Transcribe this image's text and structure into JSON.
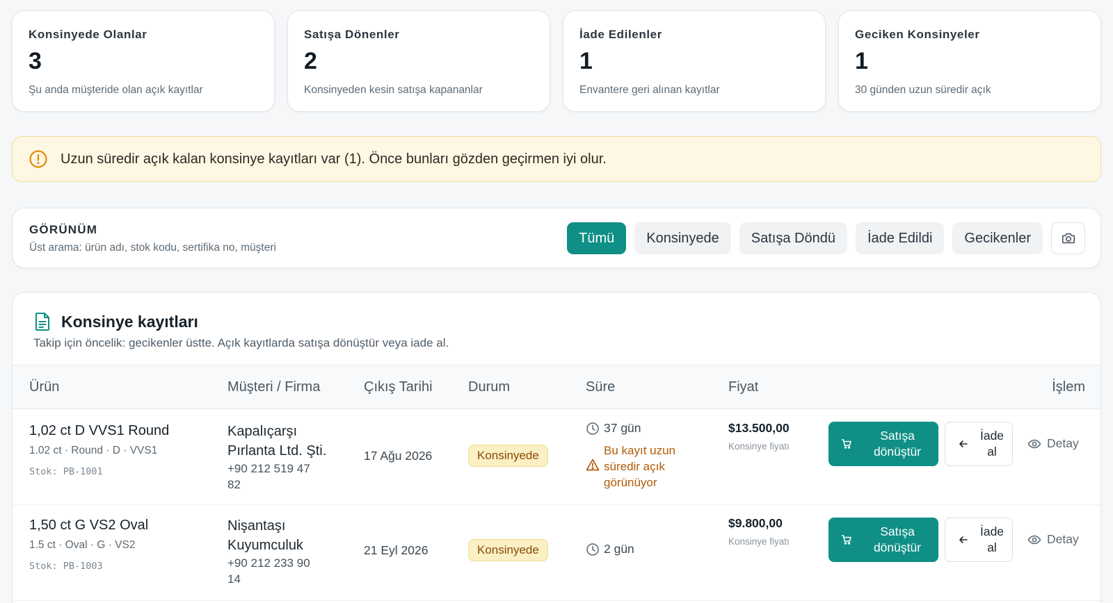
{
  "stats": [
    {
      "title": "Konsinyede Olanlar",
      "value": "3",
      "subtitle": "Şu anda müşteride olan açık kayıtlar"
    },
    {
      "title": "Satışa Dönenler",
      "value": "2",
      "subtitle": "Konsinyeden kesin satışa kapananlar"
    },
    {
      "title": "İade Edilenler",
      "value": "1",
      "subtitle": "Envantere geri alınan kayıtlar"
    },
    {
      "title": "Geciken Konsinyeler",
      "value": "1",
      "subtitle": "30 günden uzun süredir açık"
    }
  ],
  "alert": {
    "icon": "alert-circle-icon",
    "text": "Uzun süredir açık kalan konsinye kayıtları var (1). Önce bunları gözden geçirmen iyi olur.",
    "color": "#e28a0c"
  },
  "view": {
    "title": "GÖRÜNÜM",
    "subtitle": "Üst arama: ürün adı, stok kodu, sertifika no, müşteri",
    "filters": [
      "Tümü",
      "Konsinyede",
      "Satışa Döndü",
      "İade Edildi",
      "Gecikenler"
    ],
    "active_filter": "Tümü",
    "camera_icon": "camera-icon"
  },
  "records": {
    "title": "Konsinye kayıtları",
    "subtitle": "Takip için öncelik: gecikenler üstte. Açık kayıtlarda satışa dönüştür veya iade al.",
    "icon": "document-icon",
    "columns": [
      "Ürün",
      "Müşteri / Firma",
      "Çıkış Tarihi",
      "Durum",
      "Süre",
      "Fiyat",
      "İşlem"
    ],
    "rows": [
      {
        "product": "1,02 ct D VVS1 Round",
        "meta": "1.02 ct · Round · D · VVS1",
        "stock": "Stok: PB-1001",
        "customer": "Kapalıçarşı Pırlanta Ltd. Şti.",
        "phone": "+90 212 519 47 82",
        "date": "17 Ağu 2026",
        "status": "Konsinyede",
        "duration": "37 gün",
        "warning": "Bu kayıt uzun süredir açık görünüyor",
        "price": "$13.500,00",
        "price_note": "Konsinye fiyatı",
        "convert_label": "Satışa dönüştür",
        "return_label": "İade al",
        "detail_label": "Detay"
      },
      {
        "product": "1,50 ct G VS2 Oval",
        "meta": "1.5 ct · Oval · G · VS2",
        "stock": "Stok: PB-1003",
        "customer": "Nişantaşı Kuyumculuk",
        "phone": "+90 212 233 90 14",
        "date": "21 Eyl 2026",
        "status": "Konsinyede",
        "duration": "2 gün",
        "warning": "",
        "price": "$9.800,00",
        "price_note": "Konsinye fiyatı",
        "convert_label": "Satışa dönüştür",
        "return_label": "İade al",
        "detail_label": "Detay"
      }
    ]
  },
  "colors": {
    "accent": "#0f8f86",
    "warning_text": "#b25a05",
    "badge_bg": "#fbefc4",
    "alert_bg": "#fdf7e3"
  }
}
